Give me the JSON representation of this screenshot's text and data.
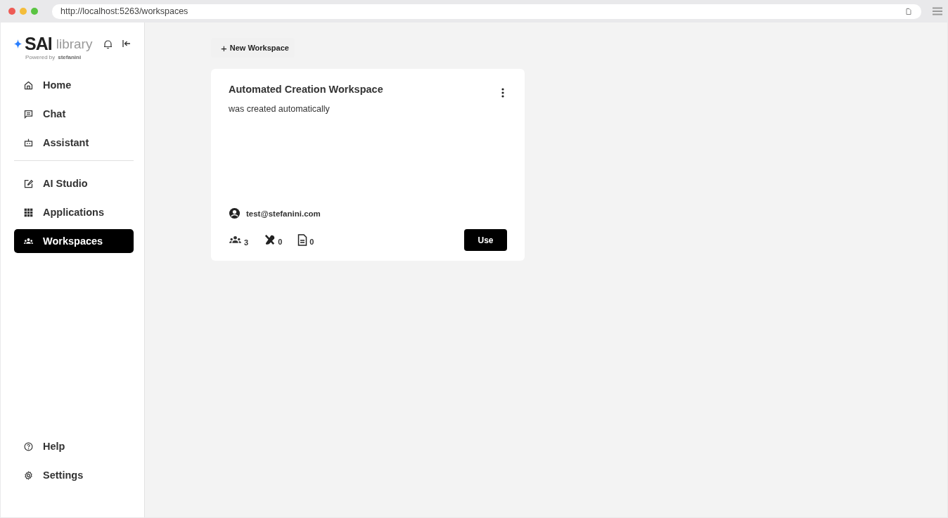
{
  "browser": {
    "url": "http://localhost:5263/workspaces"
  },
  "sidebar": {
    "logo": {
      "brand": "SAI",
      "product": "library",
      "powered_by": "Powered by",
      "company": "stefanini"
    },
    "items": [
      {
        "label": "Home",
        "selected": false
      },
      {
        "label": "Chat",
        "selected": false
      },
      {
        "label": "Assistant",
        "selected": false
      },
      {
        "kind": "divider"
      },
      {
        "label": "AI Studio",
        "selected": false
      },
      {
        "label": "Applications",
        "selected": false
      },
      {
        "label": "Workspaces",
        "selected": true
      }
    ],
    "footer_items": [
      {
        "label": "Help",
        "selected": false
      },
      {
        "label": "Settings",
        "selected": false
      }
    ]
  },
  "new_workspace_button": {
    "icon": "+",
    "label": "New Workspace"
  },
  "workspaces": [
    {
      "title": "Automated Creation Workspace",
      "description": "was created automatically",
      "owner": "test@stefanini.com",
      "members": "3",
      "tools": "0",
      "documents": "0",
      "action": "Use"
    }
  ]
}
